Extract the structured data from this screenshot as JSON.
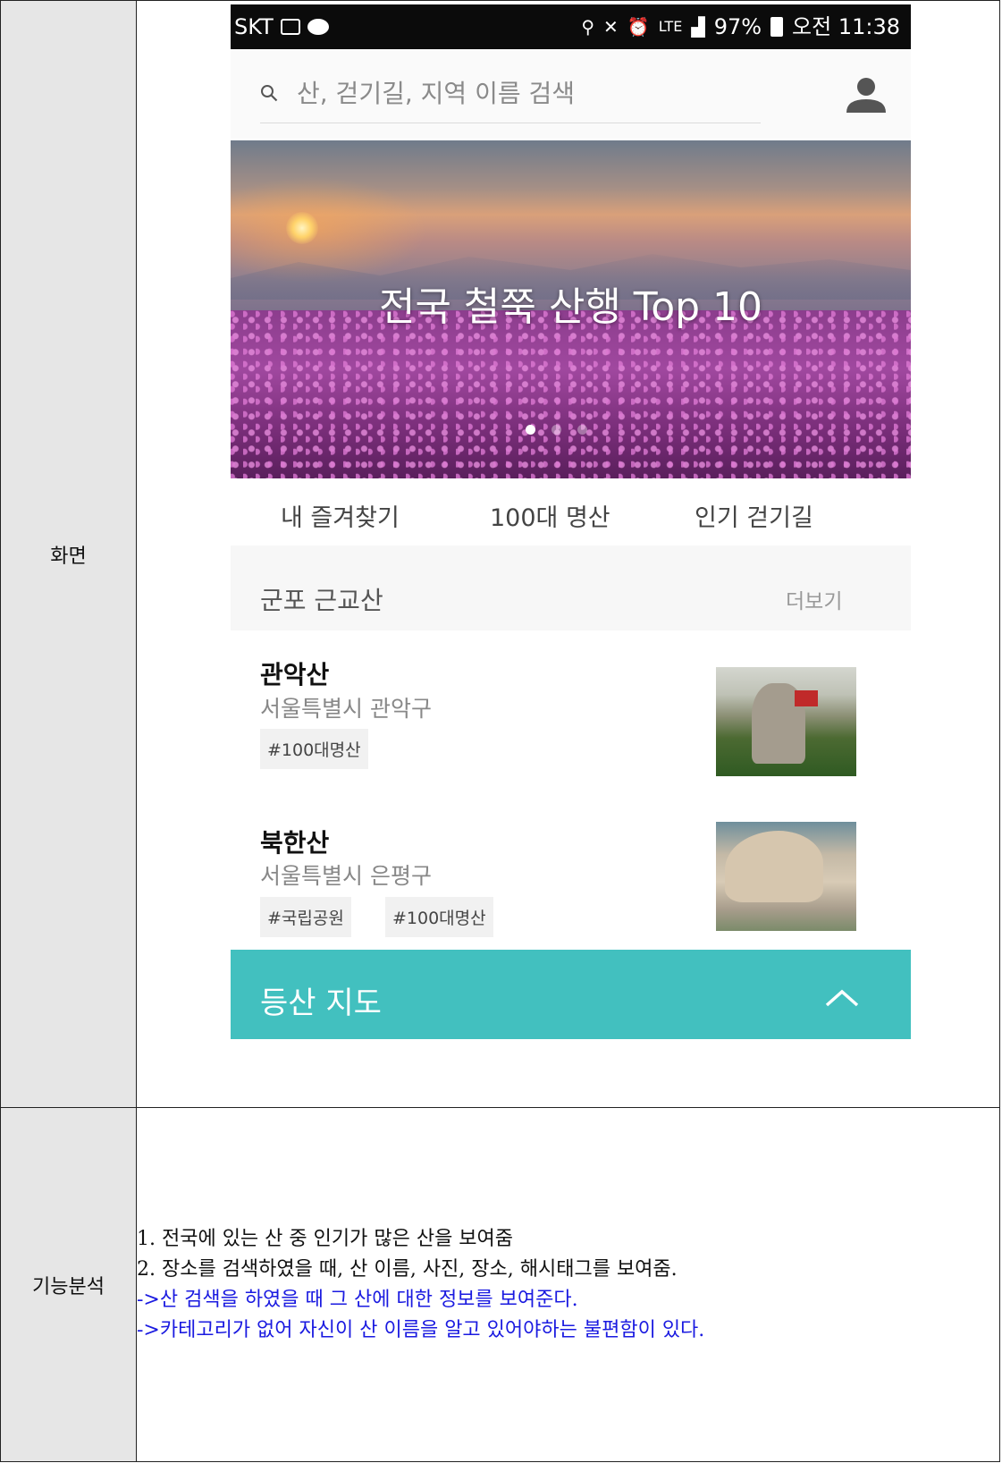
{
  "table": {
    "row1_label": "화면",
    "row2_label": "기능분석"
  },
  "statusbar": {
    "carrier": "SKT",
    "network": "LTE",
    "battery": "97%",
    "time": "오전 11:38"
  },
  "search": {
    "placeholder": "산, 걷기길, 지역 이름 검색"
  },
  "banner": {
    "title": "전국 철쭉 산행 Top 10",
    "page_count": 3,
    "active_page": 1
  },
  "tabs": [
    "내 즐겨찾기",
    "100대 명산",
    "인기 걷기길"
  ],
  "section": {
    "title": "군포 근교산",
    "more_label": "더보기"
  },
  "mountains": [
    {
      "name": "관악산",
      "address": "서울특별시 관악구",
      "tags": [
        "#100대명산"
      ]
    },
    {
      "name": "북한산",
      "address": "서울특별시 은평구",
      "tags": [
        "#국립공원",
        "#100대명산"
      ]
    }
  ],
  "map_bar": {
    "title": "등산 지도"
  },
  "analysis": {
    "lines": [
      "1. 전국에 있는 산 중 인기가 많은 산을 보여줌",
      "2. 장소를 검색하였을 때, 산 이름, 사진, 장소, 해시태그를 보여줌.",
      "->산 검색을 하였을 때 그 산에 대한 정보를 보여준다.",
      "->카테고리가 없어 자신이 산 이름을 알고 있어야하는 불편함이 있다."
    ]
  },
  "colors": {
    "accent_teal": "#42c0bf",
    "analysis_blue": "#1a1ae0",
    "label_cell_gray": "#e6e6e6"
  }
}
